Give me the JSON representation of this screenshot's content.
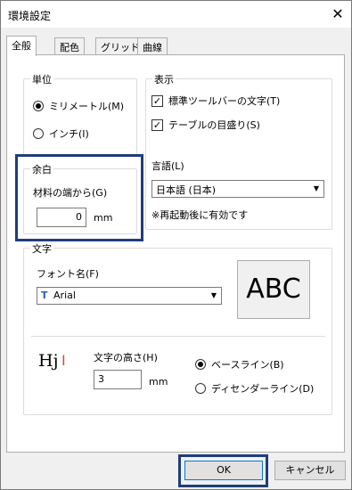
{
  "window": {
    "title": "環境設定",
    "close_label": "✕"
  },
  "tabs": [
    {
      "label": "全般"
    },
    {
      "label": "配色"
    },
    {
      "label": "グリッド"
    },
    {
      "label": "曲線"
    }
  ],
  "units": {
    "group_label": "単位",
    "options": [
      "ミリメートル(M)",
      "インチ(I)"
    ],
    "selected": "ミリメートル(M)"
  },
  "display": {
    "group_label": "表示",
    "checkboxes": [
      {
        "label": "標準ツールバーの文字(T)",
        "checked": true
      },
      {
        "label": "テーブルの目盛り(S)",
        "checked": true
      }
    ],
    "language_label": "言語(L)",
    "language_value": "日本語 (日本)",
    "restart_note": "※再起動後に有効です"
  },
  "margin": {
    "group_label": "余白",
    "field_label": "材料の端から(G)",
    "value": "0",
    "unit": "mm"
  },
  "text": {
    "group_label": "文字",
    "font_label": "フォント名(F)",
    "font_value": "Arial",
    "font_icon": "truetype-font-icon",
    "preview_text": "ABC",
    "sample_text": "Hj",
    "height_label": "文字の高さ(H)",
    "height_value": "3",
    "height_unit": "mm",
    "baseline_options": [
      "ベースライン(B)",
      "ディセンダーライン(D)"
    ],
    "baseline_selected": "ベースライン(B)"
  },
  "buttons": {
    "ok": "OK",
    "cancel": "キャンセル"
  },
  "colors": {
    "highlight": "#1f3d7a",
    "tab_bg": "#ffffff",
    "dialog_bg": "#f0f0f0"
  }
}
